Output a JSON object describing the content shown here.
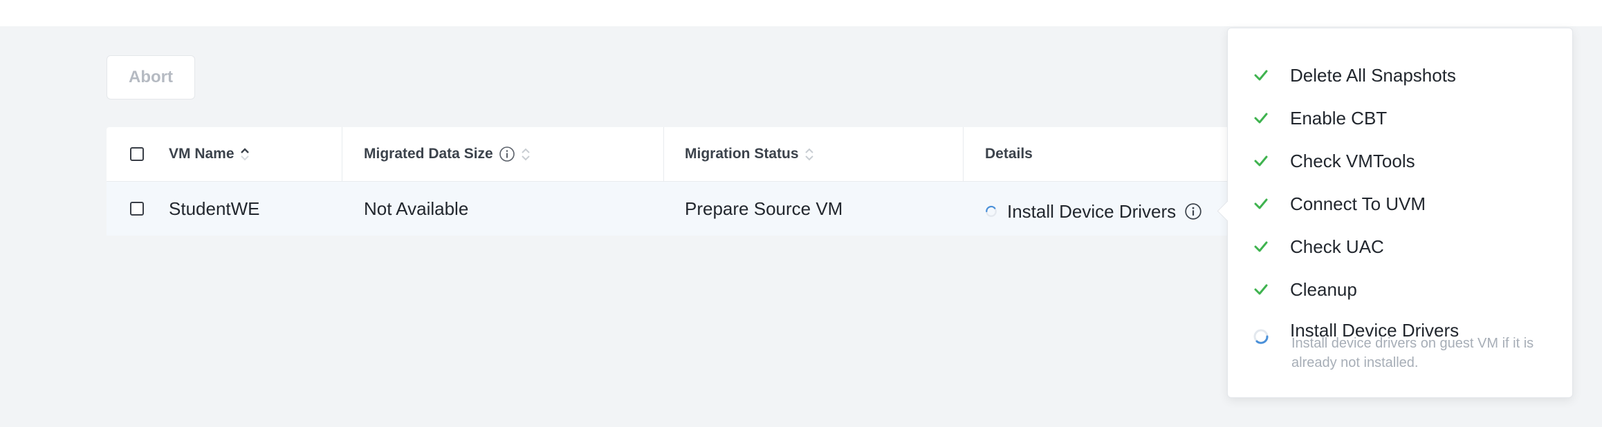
{
  "toolbar": {
    "abort_label": "Abort"
  },
  "table": {
    "headers": {
      "vm_name": "VM Name",
      "migrated_data_size": "Migrated Data Size",
      "migration_status": "Migration Status",
      "details": "Details"
    },
    "rows": [
      {
        "vm_name": "StudentWE",
        "migrated_data_size": "Not Available",
        "migration_status": "Prepare Source VM",
        "details": "Install Device Drivers"
      }
    ]
  },
  "popover": {
    "steps": [
      {
        "label": "Delete All Snapshots",
        "state": "done"
      },
      {
        "label": "Enable CBT",
        "state": "done"
      },
      {
        "label": "Check VMTools",
        "state": "done"
      },
      {
        "label": "Connect To UVM",
        "state": "done"
      },
      {
        "label": "Check UAC",
        "state": "done"
      },
      {
        "label": "Cleanup",
        "state": "done"
      },
      {
        "label": "Install Device Drivers",
        "state": "in-progress"
      }
    ],
    "active_step_description": "Install device drivers on guest VM if it is already not installed."
  },
  "colors": {
    "check": "#3fb34f",
    "spinner": "#4a90d9",
    "page_background": "#f2f4f6",
    "muted_text": "#a7aeb7"
  }
}
